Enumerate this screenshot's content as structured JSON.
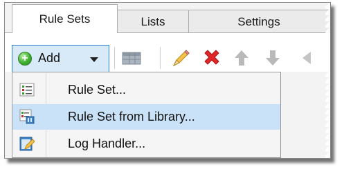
{
  "tabs": [
    {
      "label": "Rule Sets",
      "active": true
    },
    {
      "label": "Lists",
      "active": false
    },
    {
      "label": "Settings",
      "active": false
    }
  ],
  "toolbar": {
    "add_label": "Add",
    "icons": [
      "add-circle-icon",
      "chevron-down-icon",
      "grid-icon",
      "pencil-icon",
      "delete-x-icon",
      "arrow-up-icon",
      "arrow-down-icon",
      "more-icon"
    ],
    "accent_color": "#2c7fd4",
    "add_background": "#d8e9f8"
  },
  "menu": {
    "items": [
      {
        "label": "Rule Set...",
        "icon": "rule-set-icon",
        "highlighted": false
      },
      {
        "label": "Rule Set from Library...",
        "icon": "library-icon",
        "highlighted": true
      },
      {
        "label": "Log Handler...",
        "icon": "log-handler-icon",
        "highlighted": false
      }
    ],
    "highlight_color": "#c9e2f7"
  }
}
